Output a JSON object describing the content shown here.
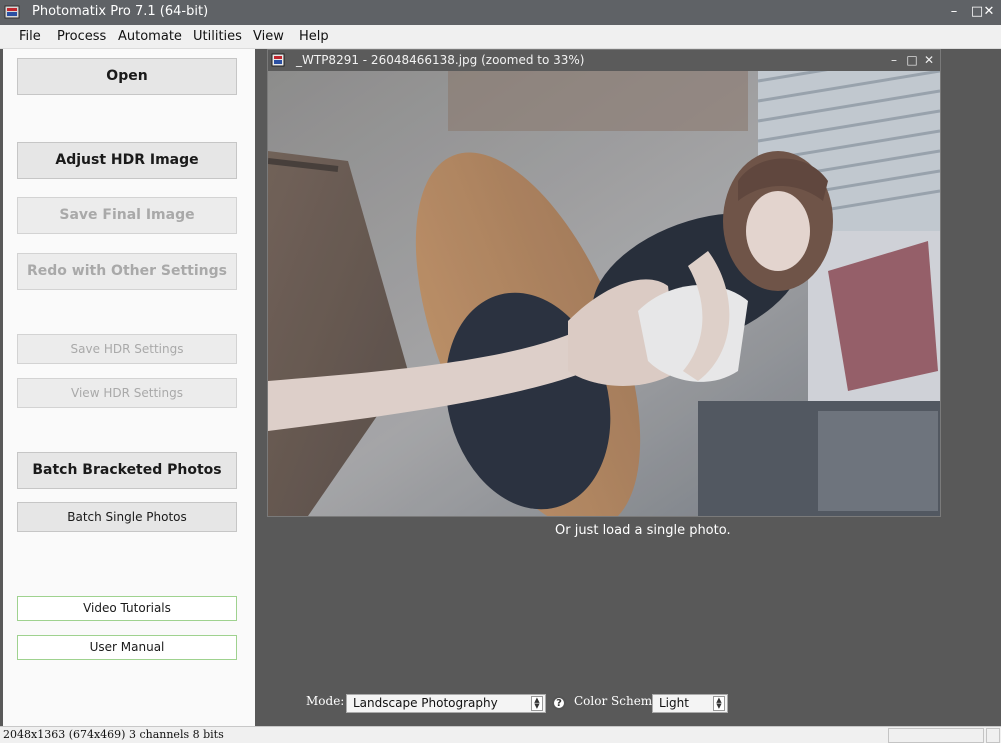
{
  "window": {
    "title": "Photomatix Pro 7.1 (64-bit)",
    "controls": {
      "minimize": "–",
      "maximize": "□",
      "close": "✕"
    }
  },
  "menu": {
    "items": [
      "File",
      "Process",
      "Automate",
      "Utilities",
      "View",
      "Help"
    ]
  },
  "sidebar": {
    "open": "Open",
    "adjust_hdr": "Adjust HDR Image",
    "save_final": "Save Final Image",
    "redo": "Redo with Other Settings",
    "save_hdr_settings": "Save HDR Settings",
    "view_hdr_settings": "View HDR Settings",
    "batch_bracketed": "Batch Bracketed Photos",
    "batch_single": "Batch Single Photos",
    "video_tutorials": "Video Tutorials",
    "user_manual": "User Manual"
  },
  "image_window": {
    "title": "_WTP8291 - 26048466138.jpg (zoomed to 33%)",
    "controls": {
      "minimize": "–",
      "maximize": "□",
      "close": "✕"
    }
  },
  "workspace": {
    "hint": "Or just load a single photo.",
    "mode_label": "Mode:",
    "mode_value": "Landscape Photography",
    "help": "?",
    "color_scheme_label": "Color Scheme:",
    "color_scheme_value": "Light"
  },
  "status": {
    "text": "2048x1363 (674x469) 3 channels 8 bits"
  }
}
